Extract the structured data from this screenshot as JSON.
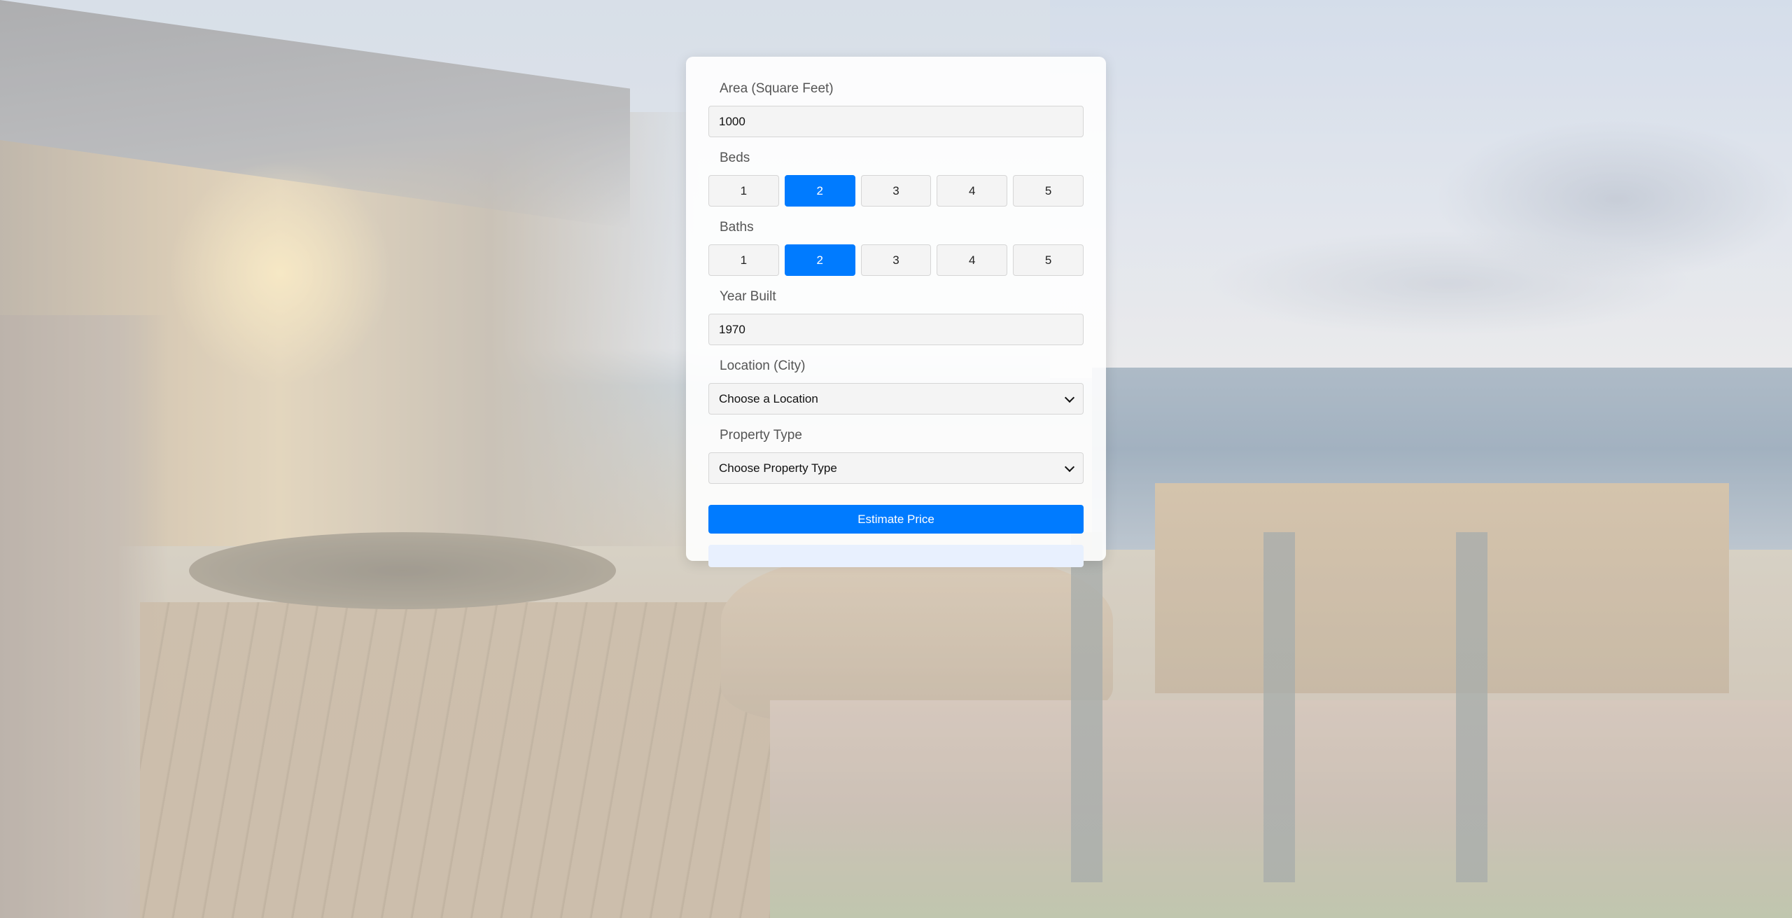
{
  "form": {
    "area": {
      "label": "Area (Square Feet)",
      "value": "1000"
    },
    "beds": {
      "label": "Beds",
      "options": [
        "1",
        "2",
        "3",
        "4",
        "5"
      ],
      "selected": "2"
    },
    "baths": {
      "label": "Baths",
      "options": [
        "1",
        "2",
        "3",
        "4",
        "5"
      ],
      "selected": "2"
    },
    "year_built": {
      "label": "Year Built",
      "value": "1970"
    },
    "location": {
      "label": "Location (City)",
      "selected": "Choose a Location"
    },
    "property_type": {
      "label": "Property Type",
      "selected": "Choose Property Type"
    },
    "estimate_button_label": "Estimate Price",
    "result_text": ""
  },
  "colors": {
    "accent": "#007bff",
    "result_bg": "#e8f0fe"
  }
}
